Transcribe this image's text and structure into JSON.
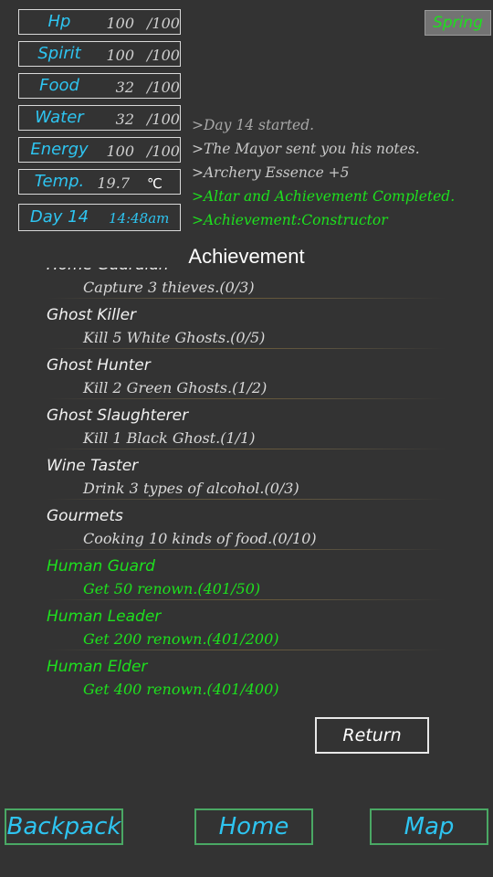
{
  "stats": [
    {
      "name": "Hp",
      "value": "100",
      "max": "/100"
    },
    {
      "name": "Spirit",
      "value": "100",
      "max": "/100"
    },
    {
      "name": "Food",
      "value": "32",
      "max": "/100"
    },
    {
      "name": "Water",
      "value": "32",
      "max": "/100"
    },
    {
      "name": "Energy",
      "value": "100",
      "max": "/100"
    }
  ],
  "temperature": {
    "name": "Temp.",
    "value": "19.7",
    "unit": "℃"
  },
  "day": {
    "label": "Day 14",
    "time": "14:48am"
  },
  "season": "Spring",
  "log": [
    {
      "text": ">Day 14 started.",
      "color": "#a8a8a8"
    },
    {
      "text": ">The Mayor sent you his notes.",
      "color": "#c8c8c8"
    },
    {
      "text": ">Archery Essence +5",
      "color": "#c8c8c8"
    },
    {
      "text": ">Altar and Achievement Completed.",
      "color": "#1ee01e"
    },
    {
      "text": ">Achievement:Constructor",
      "color": "#1ee01e"
    }
  ],
  "achievement_title": "Achievement",
  "achievements": [
    {
      "title": "Home Guardian",
      "desc": "Capture 3 thieves.(0/3)",
      "done": false
    },
    {
      "title": "Ghost Killer",
      "desc": "Kill 5 White Ghosts.(0/5)",
      "done": false
    },
    {
      "title": "Ghost Hunter",
      "desc": "Kill 2 Green Ghosts.(1/2)",
      "done": false
    },
    {
      "title": "Ghost Slaughterer",
      "desc": "Kill 1 Black Ghost.(1/1)",
      "done": false
    },
    {
      "title": "Wine Taster",
      "desc": "Drink 3 types of alcohol.(0/3)",
      "done": false
    },
    {
      "title": "Gourmets",
      "desc": "Cooking 10 kinds of food.(0/10)",
      "done": false
    },
    {
      "title": "Human Guard",
      "desc": "Get 50 renown.(401/50)",
      "done": true
    },
    {
      "title": "Human Leader",
      "desc": "Get 200 renown.(401/200)",
      "done": true
    },
    {
      "title": "Human Elder",
      "desc": "Get 400 renown.(401/400)",
      "done": true
    }
  ],
  "colors": {
    "done": "#1ee01e",
    "title": "#f2f2f2",
    "desc": "#d8d8d8"
  },
  "buttons": {
    "return": "Return",
    "backpack": "Backpack",
    "home": "Home",
    "map": "Map"
  }
}
